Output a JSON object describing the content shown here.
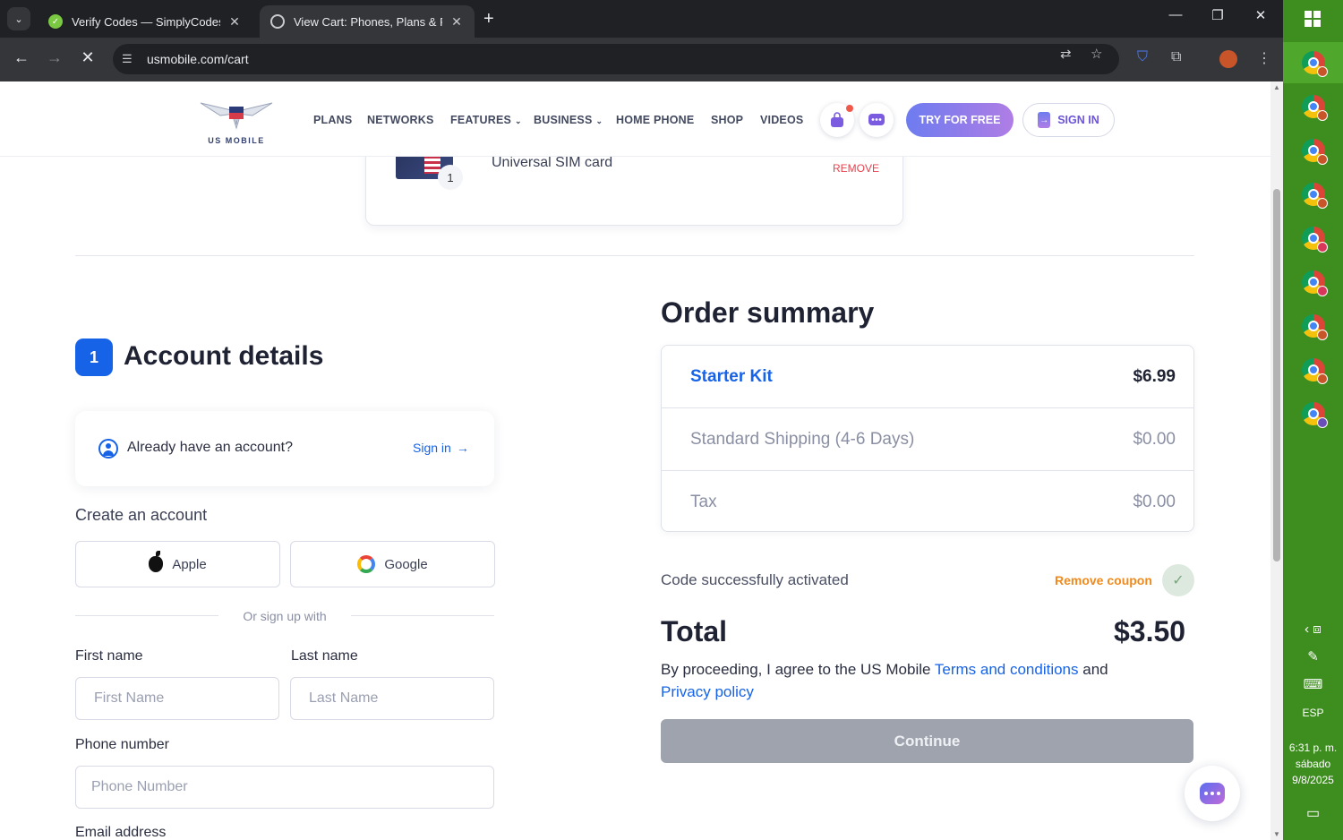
{
  "browser": {
    "tabs": [
      {
        "title": "Verify Codes — SimplyCodes",
        "active": false
      },
      {
        "title": "View Cart: Phones, Plans & Payments",
        "active": true
      }
    ],
    "url": "usmobile.com/cart"
  },
  "header": {
    "logo_text": "US MOBILE",
    "nav": [
      "PLANS",
      "NETWORKS",
      "FEATURES",
      "BUSINESS",
      "HOME PHONE",
      "SHOP",
      "VIDEOS"
    ],
    "try_free": "TRY FOR FREE",
    "sign_in": "SIGN IN"
  },
  "cart_item": {
    "name": "Universal SIM card",
    "quantity": "1",
    "remove": "REMOVE"
  },
  "account": {
    "step": "1",
    "heading": "Account details",
    "have_account": "Already have an account?",
    "sign_in_link": "Sign in",
    "create_label": "Create an account",
    "apple": "Apple",
    "google": "Google",
    "or_text": "Or sign up with",
    "first_name_label": "First name",
    "first_name_placeholder": "First Name",
    "last_name_label": "Last name",
    "last_name_placeholder": "Last Name",
    "phone_label": "Phone number",
    "phone_placeholder": "Phone Number",
    "email_label": "Email address"
  },
  "summary": {
    "heading": "Order summary",
    "rows": [
      {
        "label": "Starter Kit",
        "value": "$6.99"
      },
      {
        "label": "Standard Shipping (4-6 Days)",
        "value": "$0.00"
      },
      {
        "label": "Tax",
        "value": "$0.00"
      }
    ],
    "coupon_message": "Code successfully activated",
    "remove_coupon": "Remove coupon",
    "total_label": "Total",
    "total_value": "$3.50",
    "terms_prefix": "By proceeding, I agree to the US Mobile",
    "terms_link": "Terms and conditions",
    "terms_and": "and",
    "privacy_link": "Privacy policy",
    "continue": "Continue"
  },
  "taskbar": {
    "lang": "ESP",
    "time": "6:31 p. m.",
    "day": "sábado",
    "date": "9/8/2025"
  }
}
